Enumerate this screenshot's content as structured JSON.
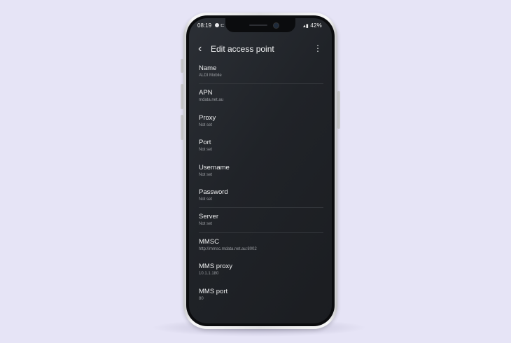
{
  "status_bar": {
    "time": "08:19",
    "battery": "42%"
  },
  "app_bar": {
    "title": "Edit access point"
  },
  "settings": [
    {
      "label": "Name",
      "value": "ALDI Mobile"
    },
    {
      "label": "APN",
      "value": "mdata.net.au"
    },
    {
      "label": "Proxy",
      "value": "Not set"
    },
    {
      "label": "Port",
      "value": "Not set"
    },
    {
      "label": "Username",
      "value": "Not set"
    },
    {
      "label": "Password",
      "value": "Not set"
    },
    {
      "label": "Server",
      "value": "Not set"
    },
    {
      "label": "MMSC",
      "value": "http://mmsc.mdata.net.au:8002"
    },
    {
      "label": "MMS proxy",
      "value": "10.1.1.180"
    },
    {
      "label": "MMS port",
      "value": "80"
    }
  ],
  "colors": {
    "background": "#e6e4f6",
    "screen": "#202328",
    "text": "#f0f1f2",
    "subtext": "#9a9da2"
  }
}
